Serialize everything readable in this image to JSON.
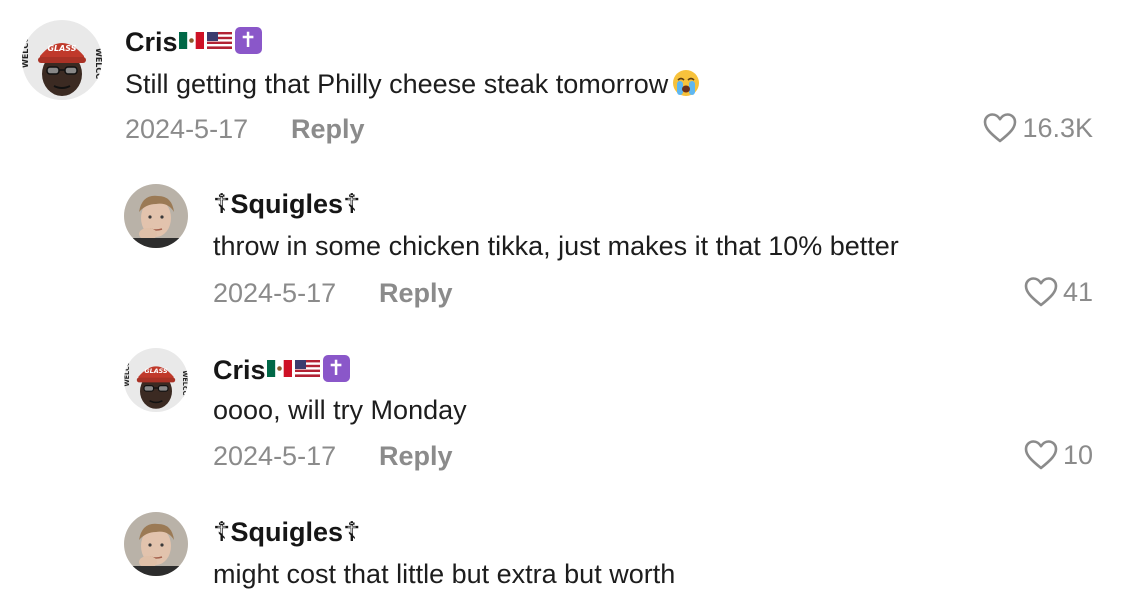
{
  "comments": [
    {
      "username": "Cris",
      "badges": [
        "mexico-flag",
        "usa-flag",
        "latin-cross"
      ],
      "cross_glyph": "✝",
      "text": "Still getting that Philly cheese steak tomorrow",
      "text_emoji": "loudly-crying-face",
      "date": "2024-5-17",
      "reply_label": "Reply",
      "likes": "16.3K",
      "avatar_badge_text": "GLASS"
    },
    {
      "username": "Squigles",
      "name_decoration": "☦",
      "text": "throw in some chicken tikka, just makes it that 10% better",
      "date": "2024-5-17",
      "reply_label": "Reply",
      "likes": "41"
    },
    {
      "username": "Cris",
      "badges": [
        "mexico-flag",
        "usa-flag",
        "latin-cross"
      ],
      "cross_glyph": "✝",
      "text": "oooo, will try Monday",
      "date": "2024-5-17",
      "reply_label": "Reply",
      "likes": "10",
      "avatar_badge_text": "GLASS"
    },
    {
      "username": "Squigles",
      "name_decoration": "☦",
      "text": "might cost that little but extra but worth"
    }
  ],
  "colors": {
    "username": "#161616",
    "text": "#1d1d1d",
    "meta": "#8b8b8b",
    "cross_badge": "#8a57c9",
    "avatar_hat": "#c0392b"
  }
}
